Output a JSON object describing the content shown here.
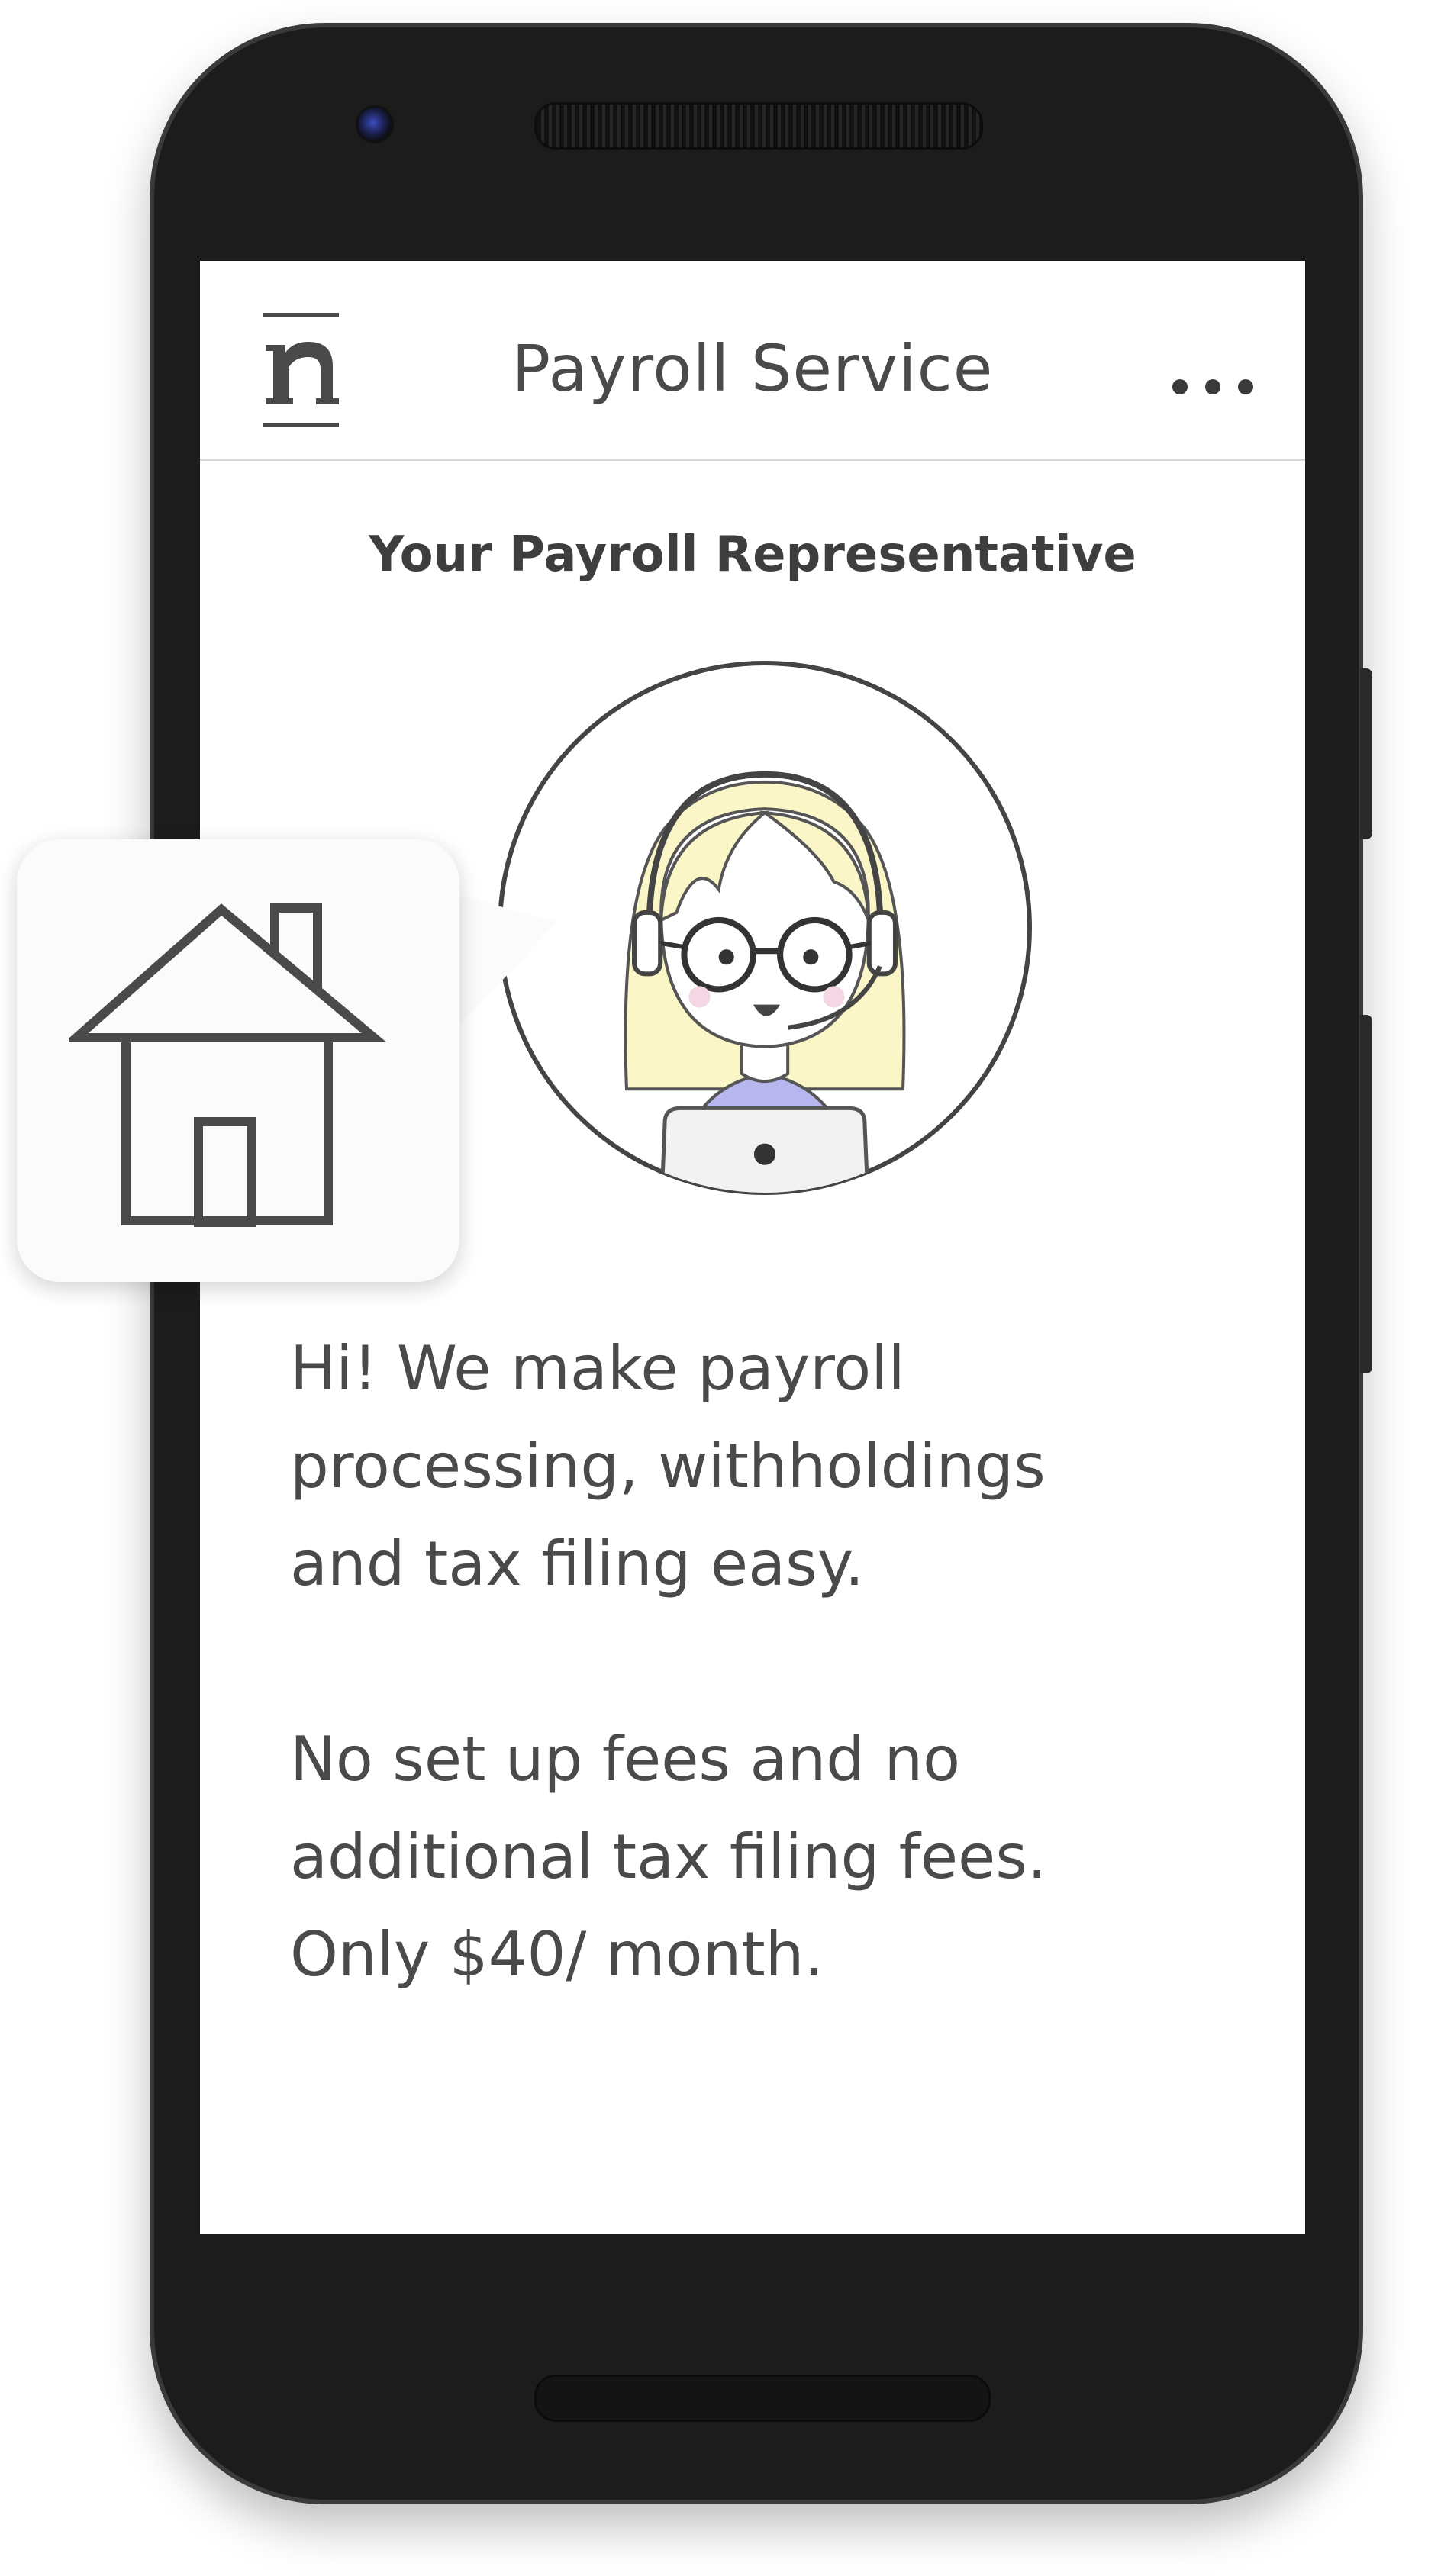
{
  "header": {
    "logo_icon": "nav-logo-n-icon",
    "title": "Payroll Service",
    "more_icon": "more-dots-icon"
  },
  "representative": {
    "title": "Your Payroll Representative",
    "avatar_icon": "headset-representative-avatar-icon"
  },
  "messages": {
    "intro": [
      "Hi! We make payroll",
      "processing, withholdings",
      "and tax filing easy."
    ],
    "pricing": [
      "No set up fees and no",
      "additional tax filing fees.",
      "Only $40/ month."
    ]
  },
  "callout": {
    "icon": "house-icon"
  },
  "colors": {
    "phone_body": "#1c1c1c",
    "screen_bg": "#ffffff",
    "text": "#4a4a4a",
    "hair": "#fbf6c7",
    "shirt": "#b7b6ee"
  }
}
